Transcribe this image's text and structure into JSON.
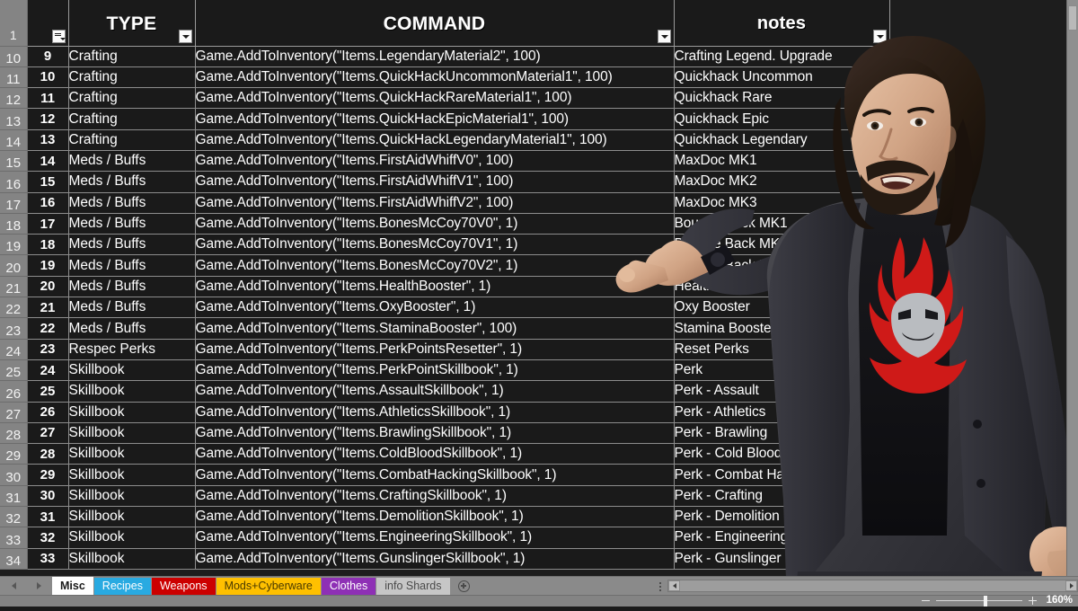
{
  "app": {
    "type": "spreadsheet",
    "zoom_label": "160%"
  },
  "grid": {
    "header_row_number": "1",
    "columns": [
      {
        "key": "rowhdr",
        "label": ""
      },
      {
        "key": "a",
        "label": "",
        "has_filter": true,
        "filter_active": true
      },
      {
        "key": "type",
        "label": "TYPE",
        "has_filter": true
      },
      {
        "key": "command",
        "label": "COMMAND",
        "has_filter": true
      },
      {
        "key": "notes",
        "label": "notes",
        "has_filter": true
      },
      {
        "key": "tail",
        "label": ""
      }
    ],
    "colors": {
      "crafting": "#27a3dd",
      "meds": "#77bb41",
      "skillbook": "#e8a816",
      "plain": "#f0f0f0",
      "cell_bg": "#1a1a1a",
      "gridline": "#8d8d8d",
      "row_header_bg": "#848484"
    },
    "rows": [
      {
        "row": "10",
        "a": "9",
        "type": "Crafting",
        "style": "crafting",
        "command": "Game.AddToInventory(\"Items.LegendaryMaterial2\", 100)",
        "notes": "Crafting Legend. Upgrade"
      },
      {
        "row": "11",
        "a": "10",
        "type": "Crafting",
        "style": "crafting",
        "command": "Game.AddToInventory(\"Items.QuickHackUncommonMaterial1\", 100)",
        "notes": "Quickhack Uncommon"
      },
      {
        "row": "12",
        "a": "11",
        "type": "Crafting",
        "style": "crafting",
        "command": "Game.AddToInventory(\"Items.QuickHackRareMaterial1\", 100)",
        "notes": "Quickhack Rare"
      },
      {
        "row": "13",
        "a": "12",
        "type": "Crafting",
        "style": "crafting",
        "command": "Game.AddToInventory(\"Items.QuickHackEpicMaterial1\", 100)",
        "notes": "Quickhack Epic"
      },
      {
        "row": "14",
        "a": "13",
        "type": "Crafting",
        "style": "crafting",
        "command": "Game.AddToInventory(\"Items.QuickHackLegendaryMaterial1\", 100)",
        "notes": "Quickhack Legendary"
      },
      {
        "row": "15",
        "a": "14",
        "type": "Meds / Buffs",
        "style": "meds",
        "command": "Game.AddToInventory(\"Items.FirstAidWhiffV0\", 100)",
        "notes": "MaxDoc MK1"
      },
      {
        "row": "16",
        "a": "15",
        "type": "Meds / Buffs",
        "style": "meds",
        "command": "Game.AddToInventory(\"Items.FirstAidWhiffV1\", 100)",
        "notes": "MaxDoc MK2"
      },
      {
        "row": "17",
        "a": "16",
        "type": "Meds / Buffs",
        "style": "meds",
        "command": "Game.AddToInventory(\"Items.FirstAidWhiffV2\", 100)",
        "notes": "MaxDoc MK3"
      },
      {
        "row": "18",
        "a": "17",
        "type": "Meds / Buffs",
        "style": "meds",
        "command": "Game.AddToInventory(\"Items.BonesMcCoy70V0\", 1)",
        "notes": "Bounce Back MK1"
      },
      {
        "row": "19",
        "a": "18",
        "type": "Meds / Buffs",
        "style": "meds",
        "command": "Game.AddToInventory(\"Items.BonesMcCoy70V1\", 1)",
        "notes": "Bounce Back MK2"
      },
      {
        "row": "20",
        "a": "19",
        "type": "Meds / Buffs",
        "style": "meds",
        "command": "Game.AddToInventory(\"Items.BonesMcCoy70V2\", 1)",
        "notes": "Bounce Back MK3"
      },
      {
        "row": "21",
        "a": "20",
        "type": "Meds / Buffs",
        "style": "meds",
        "command": "Game.AddToInventory(\"Items.HealthBooster\", 1)",
        "notes": "Health Booster"
      },
      {
        "row": "22",
        "a": "21",
        "type": "Meds / Buffs",
        "style": "meds",
        "command": "Game.AddToInventory(\"Items.OxyBooster\", 1)",
        "notes": "Oxy Booster"
      },
      {
        "row": "23",
        "a": "22",
        "type": "Meds / Buffs",
        "style": "meds",
        "command": "Game.AddToInventory(\"Items.StaminaBooster\", 100)",
        "notes": "Stamina Booster"
      },
      {
        "row": "24",
        "a": "23",
        "type": "Respec Perks",
        "style": "plain",
        "command": "Game.AddToInventory(\"Items.PerkPointsResetter\", 1)",
        "notes": "Reset Perks"
      },
      {
        "row": "25",
        "a": "24",
        "type": "Skillbook",
        "style": "skillbook",
        "command": "Game.AddToInventory(\"Items.PerkPointSkillbook\", 1)",
        "notes": "Perk"
      },
      {
        "row": "26",
        "a": "25",
        "type": "Skillbook",
        "style": "skillbook",
        "command": "Game.AddToInventory(\"Items.AssaultSkillbook\", 1)",
        "notes": "Perk - Assault"
      },
      {
        "row": "27",
        "a": "26",
        "type": "Skillbook",
        "style": "skillbook",
        "command": "Game.AddToInventory(\"Items.AthleticsSkillbook\", 1)",
        "notes": "Perk - Athletics"
      },
      {
        "row": "28",
        "a": "27",
        "type": "Skillbook",
        "style": "skillbook",
        "command": "Game.AddToInventory(\"Items.BrawlingSkillbook\", 1)",
        "notes": "Perk - Brawling"
      },
      {
        "row": "29",
        "a": "28",
        "type": "Skillbook",
        "style": "skillbook",
        "command": "Game.AddToInventory(\"Items.ColdBloodSkillbook\", 1)",
        "notes": "Perk - Cold Blood"
      },
      {
        "row": "30",
        "a": "29",
        "type": "Skillbook",
        "style": "skillbook",
        "command": "Game.AddToInventory(\"Items.CombatHackingSkillbook\", 1)",
        "notes": "Perk - Combat Hacking"
      },
      {
        "row": "31",
        "a": "30",
        "type": "Skillbook",
        "style": "skillbook",
        "command": "Game.AddToInventory(\"Items.CraftingSkillbook\", 1)",
        "notes": "Perk - Crafting"
      },
      {
        "row": "32",
        "a": "31",
        "type": "Skillbook",
        "style": "skillbook",
        "command": "Game.AddToInventory(\"Items.DemolitionSkillbook\", 1)",
        "notes": "Perk - Demolition"
      },
      {
        "row": "33",
        "a": "32",
        "type": "Skillbook",
        "style": "skillbook",
        "command": "Game.AddToInventory(\"Items.EngineeringSkillbook\", 1)",
        "notes": "Perk - Engineering"
      },
      {
        "row": "34",
        "a": "33",
        "type": "Skillbook",
        "style": "skillbook",
        "command": "Game.AddToInventory(\"Items.GunslingerSkillbook\", 1)",
        "notes": "Perk - Gunslinger"
      }
    ]
  },
  "sheet_tabs": [
    {
      "label": "Misc",
      "bg": "#ffffff",
      "fg": "#1a1a1a",
      "active": true
    },
    {
      "label": "Recipes",
      "bg": "#29aae1",
      "fg": "#ffffff",
      "active": false
    },
    {
      "label": "Weapons",
      "bg": "#cc0000",
      "fg": "#ffffff",
      "active": false
    },
    {
      "label": "Mods+Cyberware",
      "bg": "#ffc000",
      "fg": "#4a3a00",
      "active": false
    },
    {
      "label": "Clothes",
      "bg": "#8e30b5",
      "fg": "#ffffff",
      "active": false
    },
    {
      "label": "info Shards",
      "bg": "#c6c6c6",
      "fg": "#4a4a4a",
      "active": false
    }
  ],
  "icons": {
    "prev_sheet": "chevron-left-icon",
    "next_sheet": "chevron-right-icon",
    "add_sheet": "plus-circle-icon",
    "zoom_out": "minus-icon",
    "zoom_in": "plus-icon"
  }
}
